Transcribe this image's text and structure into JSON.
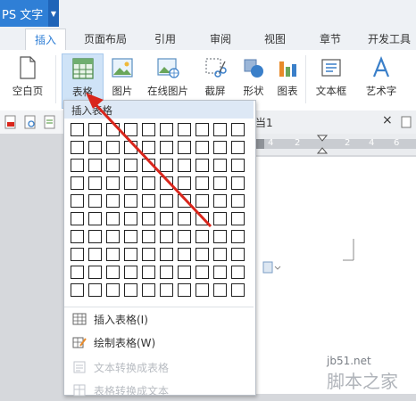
{
  "app": {
    "title": "PS 文字"
  },
  "tabs": [
    {
      "label": "插入",
      "active": true
    },
    {
      "label": "页面布局"
    },
    {
      "label": "引用"
    },
    {
      "label": "审阅"
    },
    {
      "label": "视图"
    },
    {
      "label": "章节"
    },
    {
      "label": "开发工具"
    }
  ],
  "ribbon": {
    "blank_page": "空白页",
    "table": "表格",
    "picture": "图片",
    "online_picture": "在线图片",
    "screenshot": "截屏",
    "shape": "形状",
    "chart": "图表",
    "textbox": "文本框",
    "wordart": "艺术字"
  },
  "dropdown": {
    "header": "插入表格",
    "grid_cols": 10,
    "grid_rows": 10,
    "items": [
      {
        "label": "插入表格(I)",
        "icon": "table-grid-icon",
        "enabled": true
      },
      {
        "label": "绘制表格(W)",
        "icon": "draw-table-icon",
        "enabled": true
      },
      {
        "label": "文本转换成表格",
        "icon": "text-to-table-icon",
        "enabled": false
      },
      {
        "label": "表格转换成文本",
        "icon": "table-to-text-icon",
        "enabled": false
      }
    ]
  },
  "docbar": {
    "tab_fragment": "当1",
    "close": "×"
  },
  "ruler": {
    "labels": [
      "4",
      "2",
      "2",
      "4",
      "6"
    ]
  },
  "watermark": {
    "site": "jb51.net",
    "brand": "脚本之家"
  },
  "colors": {
    "accent": "#2f7fd6",
    "arrow": "#d9261c"
  }
}
